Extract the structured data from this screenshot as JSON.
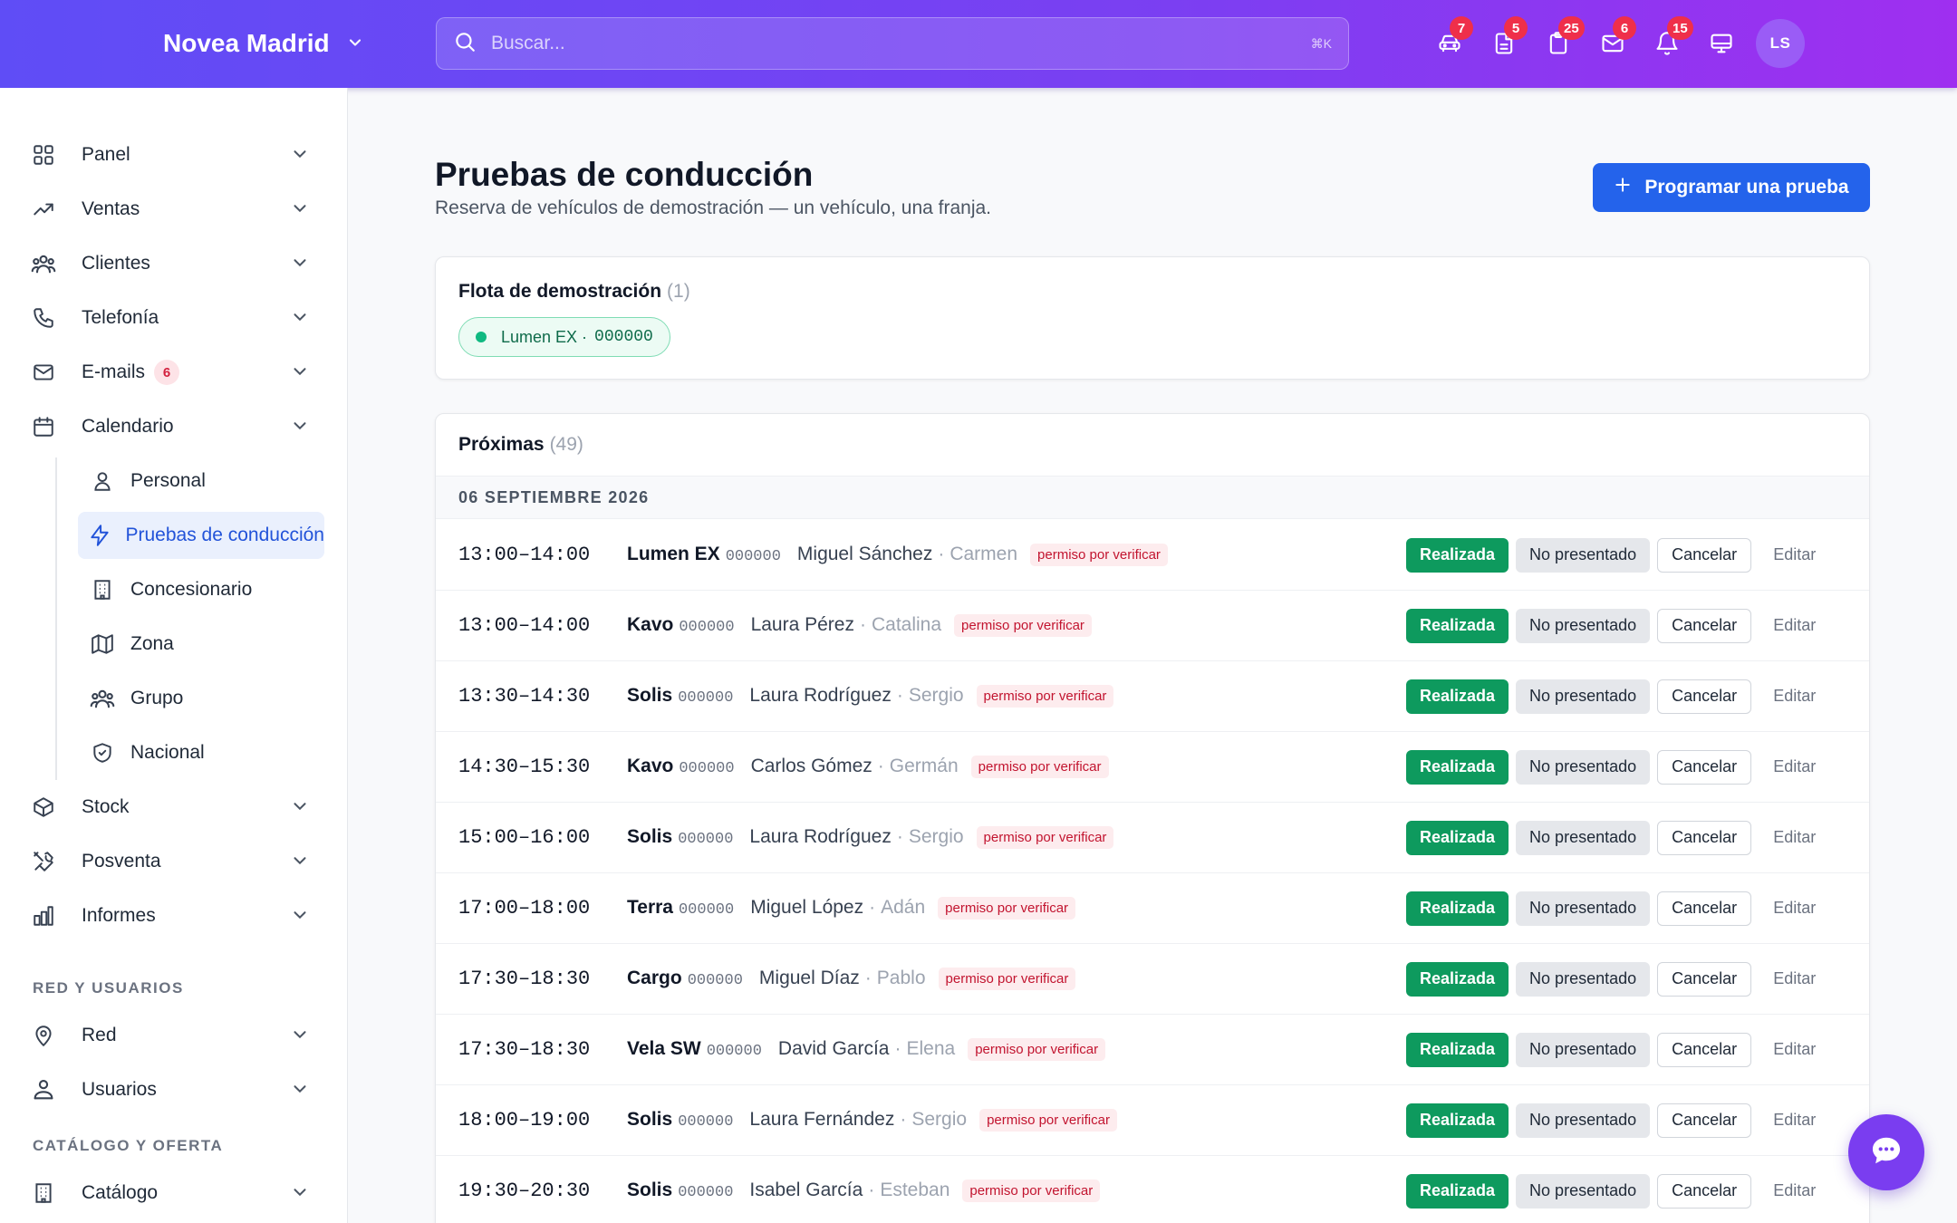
{
  "header": {
    "brand": "Novea Madrid",
    "search_placeholder": "Buscar...",
    "search_shortcut": "⌘K",
    "icons": [
      {
        "name": "car-icon",
        "badge": "7"
      },
      {
        "name": "document-icon",
        "badge": "5"
      },
      {
        "name": "clipboard-icon",
        "badge": "25"
      },
      {
        "name": "mail-icon",
        "badge": "6"
      },
      {
        "name": "bell-icon",
        "badge": "15"
      },
      {
        "name": "monitor-icon",
        "badge": ""
      }
    ],
    "avatar": "LS"
  },
  "sidebar": {
    "items": [
      {
        "label": "Panel",
        "icon": "grid-icon"
      },
      {
        "label": "Ventas",
        "icon": "trending-up-icon"
      },
      {
        "label": "Clientes",
        "icon": "users-icon"
      },
      {
        "label": "Telefonía",
        "icon": "phone-icon"
      },
      {
        "label": "E-mails",
        "icon": "mail-icon",
        "badge": "6"
      },
      {
        "label": "Calendario",
        "icon": "calendar-icon"
      }
    ],
    "calendar_sub": [
      {
        "label": "Personal",
        "icon": "person-icon"
      },
      {
        "label": "Pruebas de conducción",
        "icon": "bolt-icon",
        "active": true
      },
      {
        "label": "Concesionario",
        "icon": "building-icon"
      },
      {
        "label": "Zona",
        "icon": "map-icon"
      },
      {
        "label": "Grupo",
        "icon": "group-icon"
      },
      {
        "label": "Nacional",
        "icon": "shield-icon"
      }
    ],
    "items_after": [
      {
        "label": "Stock",
        "icon": "box-icon"
      },
      {
        "label": "Posventa",
        "icon": "tools-icon"
      },
      {
        "label": "Informes",
        "icon": "chart-icon"
      }
    ],
    "section_network": "RED Y USUARIOS",
    "network_items": [
      {
        "label": "Red",
        "icon": "location-icon"
      },
      {
        "label": "Usuarios",
        "icon": "user-cog-icon"
      }
    ],
    "section_catalog": "CATÁLOGO Y OFERTA",
    "catalog_items": [
      {
        "label": "Catálogo",
        "icon": "building-icon"
      }
    ]
  },
  "main": {
    "title": "Pruebas de conducción",
    "subtitle": "Reserva de vehículos de demostración — un vehículo, una franja.",
    "primary_button": "Programar una prueba",
    "fleet": {
      "title": "Flota de demostración",
      "count": "(1)",
      "chip_model": "Lumen EX ·",
      "chip_plate": "000000"
    },
    "upcoming": {
      "title": "Próximas",
      "count": "(49)",
      "date_header": "06 SEPTIEMBRE 2026",
      "rows": [
        {
          "time": "13:00–14:00",
          "model": "Lumen EX",
          "plate": "000000",
          "client": "Miguel Sánchez",
          "seller": "Carmen",
          "tag": "permiso por verificar"
        },
        {
          "time": "13:00–14:00",
          "model": "Kavo",
          "plate": "000000",
          "client": "Laura Pérez",
          "seller": "Catalina",
          "tag": "permiso por verificar"
        },
        {
          "time": "13:30–14:30",
          "model": "Solis",
          "plate": "000000",
          "client": "Laura Rodríguez",
          "seller": "Sergio",
          "tag": "permiso por verificar"
        },
        {
          "time": "14:30–15:30",
          "model": "Kavo",
          "plate": "000000",
          "client": "Carlos Gómez",
          "seller": "Germán",
          "tag": "permiso por verificar"
        },
        {
          "time": "15:00–16:00",
          "model": "Solis",
          "plate": "000000",
          "client": "Laura Rodríguez",
          "seller": "Sergio",
          "tag": "permiso por verificar"
        },
        {
          "time": "17:00–18:00",
          "model": "Terra",
          "plate": "000000",
          "client": "Miguel López",
          "seller": "Adán",
          "tag": "permiso por verificar"
        },
        {
          "time": "17:30–18:30",
          "model": "Cargo",
          "plate": "000000",
          "client": "Miguel Díaz",
          "seller": "Pablo",
          "tag": "permiso por verificar"
        },
        {
          "time": "17:30–18:30",
          "model": "Vela SW",
          "plate": "000000",
          "client": "David García",
          "seller": "Elena",
          "tag": "permiso por verificar"
        },
        {
          "time": "18:00–19:00",
          "model": "Solis",
          "plate": "000000",
          "client": "Laura Fernández",
          "seller": "Sergio",
          "tag": "permiso por verificar"
        },
        {
          "time": "19:30–20:30",
          "model": "Solis",
          "plate": "000000",
          "client": "Isabel García",
          "seller": "Esteban",
          "tag": "permiso por verificar"
        }
      ],
      "actions": {
        "done": "Realizada",
        "no_show": "No presentado",
        "cancel": "Cancelar",
        "edit": "Editar"
      }
    }
  },
  "colors": {
    "accent": "#2463eb",
    "header_from": "#5f4df6",
    "header_to": "#9f2ff0",
    "success": "#0e9a5e",
    "danger": "#ef2f4a"
  }
}
